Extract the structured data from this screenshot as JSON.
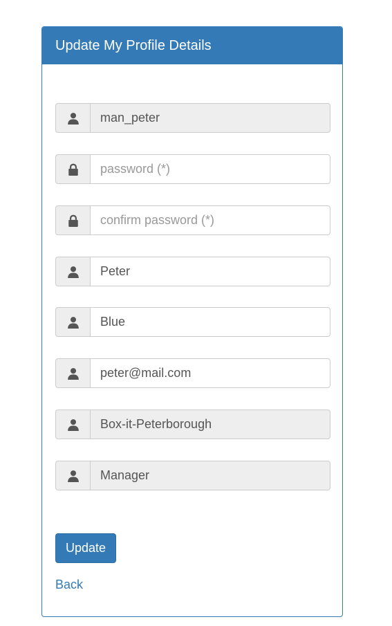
{
  "panel": {
    "title": "Update My Profile Details"
  },
  "form": {
    "username": {
      "value": "man_peter",
      "placeholder": "",
      "icon": "user-icon"
    },
    "password": {
      "value": "",
      "placeholder": "password (*)",
      "icon": "lock-icon"
    },
    "confirm_password": {
      "value": "",
      "placeholder": "confirm password (*)",
      "icon": "lock-icon"
    },
    "first_name": {
      "value": "Peter",
      "placeholder": "",
      "icon": "user-icon"
    },
    "last_name": {
      "value": "Blue",
      "placeholder": "",
      "icon": "user-icon"
    },
    "email": {
      "value": "peter@mail.com",
      "placeholder": "",
      "icon": "user-icon"
    },
    "branch": {
      "value": "Box-it-Peterborough",
      "placeholder": "",
      "icon": "user-icon"
    },
    "role": {
      "value": "Manager",
      "placeholder": "",
      "icon": "user-icon"
    }
  },
  "actions": {
    "update_label": "Update",
    "back_label": "Back"
  },
  "colors": {
    "primary": "#337ab7",
    "addon_bg": "#eeeeee",
    "border": "#cccccc"
  }
}
